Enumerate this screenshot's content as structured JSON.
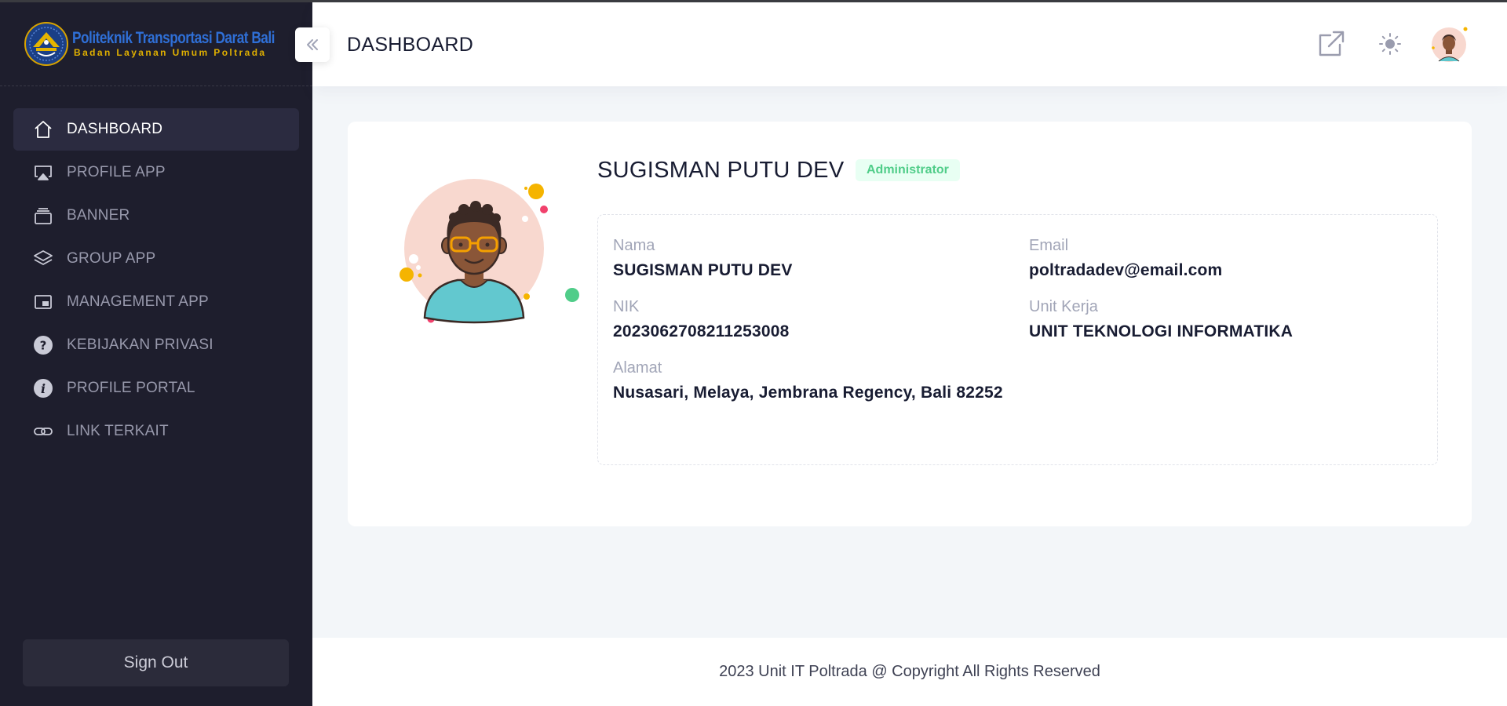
{
  "brand": {
    "title": "Politeknik Transportasi Darat Bali",
    "subtitle": "Badan Layanan Umum Poltrada"
  },
  "sidebar": {
    "items": [
      {
        "label": "DASHBOARD",
        "icon": "home-icon",
        "active": true
      },
      {
        "label": "PROFILE APP",
        "icon": "airplay-icon",
        "active": false
      },
      {
        "label": "BANNER",
        "icon": "stack-icon",
        "active": false
      },
      {
        "label": "GROUP APP",
        "icon": "layers-icon",
        "active": false
      },
      {
        "label": "MANAGEMENT APP",
        "icon": "picture-in-picture-icon",
        "active": false
      },
      {
        "label": "KEBIJAKAN PRIVASI",
        "icon": "question-circle-icon",
        "active": false
      },
      {
        "label": "PROFILE PORTAL",
        "icon": "info-circle-icon",
        "active": false
      },
      {
        "label": "LINK TERKAIT",
        "icon": "link-icon",
        "active": false
      }
    ],
    "signout_label": "Sign Out"
  },
  "header": {
    "title": "DASHBOARD",
    "collapse_icon": "chevron-double-left-icon",
    "icons": [
      "external-link-icon",
      "sun-icon",
      "user-avatar"
    ]
  },
  "profile": {
    "name": "SUGISMAN PUTU DEV",
    "role": "Administrator",
    "fields": {
      "nama": {
        "label": "Nama",
        "value": "SUGISMAN PUTU DEV"
      },
      "email": {
        "label": "Email",
        "value": "poltradadev@email.com"
      },
      "nik": {
        "label": "NIK",
        "value": "2023062708211253008"
      },
      "unit_kerja": {
        "label": "Unit Kerja",
        "value": "UNIT TEKNOLOGI INFORMATIKA"
      },
      "alamat": {
        "label": "Alamat",
        "value": "Nusasari, Melaya, Jembrana Regency, Bali 82252"
      }
    }
  },
  "footer": {
    "text": "2023 Unit IT Poltrada @ Copyright All Rights Reserved"
  },
  "colors": {
    "sidebar_bg": "#1e1e2d",
    "active_item_bg": "#2b2b40",
    "badge_green": "#50cd89",
    "page_bg": "#f3f6f9"
  }
}
